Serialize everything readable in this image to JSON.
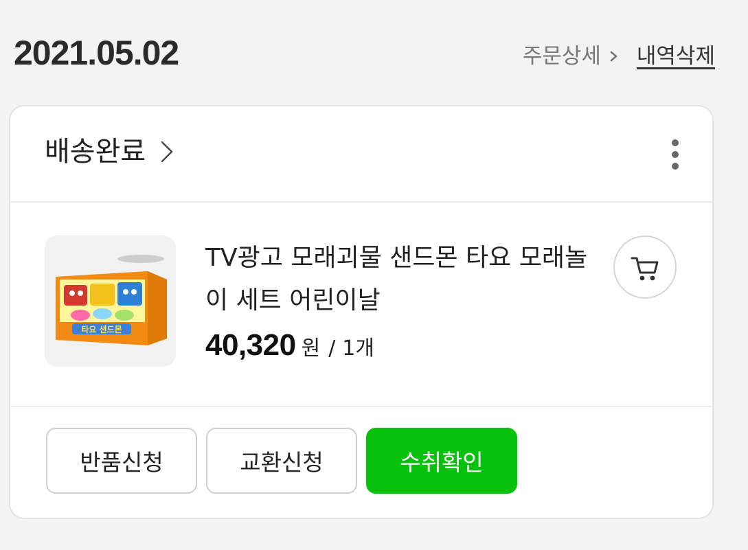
{
  "order": {
    "date": "2021.05.02",
    "detail_link": "주문상세",
    "delete_link": "내역삭제"
  },
  "card": {
    "status": "배송완료",
    "more_icon": "more-vertical-icon"
  },
  "product": {
    "name": "TV광고 모래괴물 샌드몬 타요 모래놀이 세트 어린이날",
    "price": "40,320",
    "currency": "원",
    "separator": "/",
    "quantity": "1개",
    "thumbnail_label": "타요 샌드몬",
    "cart_icon": "cart-icon"
  },
  "actions": {
    "return": "반품신청",
    "exchange": "교환신청",
    "confirm": "수취확인"
  },
  "colors": {
    "accent": "#08c10c",
    "background": "#f3f3f3"
  }
}
